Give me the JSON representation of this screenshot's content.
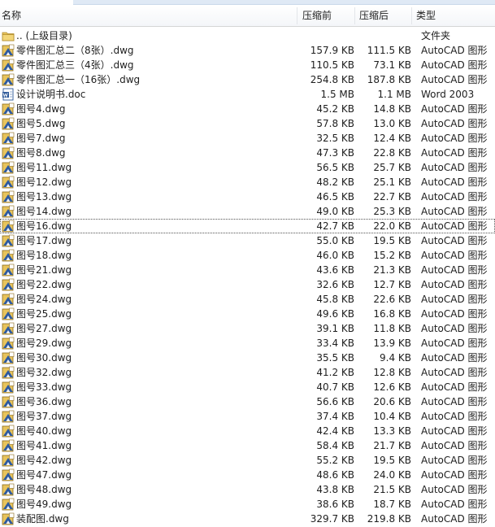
{
  "columns": {
    "name": "名称",
    "compressed": "压缩前",
    "original": "压缩后",
    "type": "类型"
  },
  "icons": {
    "folder": "folder-icon",
    "dwg": "autocad-file-icon",
    "doc": "word-document-icon"
  },
  "colors": {
    "focus_outline": "#555555",
    "header_border": "#d5d5d5",
    "folder_yellow": "#e8c45c",
    "word_blue": "#2b5797"
  },
  "rows": [
    {
      "name": ".. (上级目录)",
      "before": "",
      "after": "",
      "type": "文件夹",
      "icon": "folder"
    },
    {
      "name": "零件图汇总二（8张）.dwg",
      "before": "157.9 KB",
      "after": "111.5 KB",
      "type": "AutoCAD 图形",
      "icon": "dwg"
    },
    {
      "name": "零件图汇总三（4张）.dwg",
      "before": "110.5 KB",
      "after": "73.1 KB",
      "type": "AutoCAD 图形",
      "icon": "dwg"
    },
    {
      "name": "零件图汇总一（16张）.dwg",
      "before": "254.8 KB",
      "after": "187.8 KB",
      "type": "AutoCAD 图形",
      "icon": "dwg"
    },
    {
      "name": "设计说明书.doc",
      "before": "1.5 MB",
      "after": "1.1 MB",
      "type": "Word 2003",
      "icon": "doc"
    },
    {
      "name": "图号4.dwg",
      "before": "45.2 KB",
      "after": "14.8 KB",
      "type": "AutoCAD 图形",
      "icon": "dwg"
    },
    {
      "name": "图号5.dwg",
      "before": "57.8 KB",
      "after": "13.0 KB",
      "type": "AutoCAD 图形",
      "icon": "dwg"
    },
    {
      "name": "图号7.dwg",
      "before": "32.5 KB",
      "after": "12.4 KB",
      "type": "AutoCAD 图形",
      "icon": "dwg"
    },
    {
      "name": "图号8.dwg",
      "before": "47.3 KB",
      "after": "22.8 KB",
      "type": "AutoCAD 图形",
      "icon": "dwg"
    },
    {
      "name": "图号11.dwg",
      "before": "56.5 KB",
      "after": "25.7 KB",
      "type": "AutoCAD 图形",
      "icon": "dwg"
    },
    {
      "name": "图号12.dwg",
      "before": "48.2 KB",
      "after": "25.1 KB",
      "type": "AutoCAD 图形",
      "icon": "dwg"
    },
    {
      "name": "图号13.dwg",
      "before": "46.5 KB",
      "after": "22.7 KB",
      "type": "AutoCAD 图形",
      "icon": "dwg"
    },
    {
      "name": "图号14.dwg",
      "before": "49.0 KB",
      "after": "25.3 KB",
      "type": "AutoCAD 图形",
      "icon": "dwg"
    },
    {
      "name": "图号16.dwg",
      "before": "42.7 KB",
      "after": "22.0 KB",
      "type": "AutoCAD 图形",
      "icon": "dwg",
      "focused": true
    },
    {
      "name": "图号17.dwg",
      "before": "55.0 KB",
      "after": "19.5 KB",
      "type": "AutoCAD 图形",
      "icon": "dwg"
    },
    {
      "name": "图号18.dwg",
      "before": "46.0 KB",
      "after": "15.2 KB",
      "type": "AutoCAD 图形",
      "icon": "dwg"
    },
    {
      "name": "图号21.dwg",
      "before": "43.6 KB",
      "after": "21.3 KB",
      "type": "AutoCAD 图形",
      "icon": "dwg"
    },
    {
      "name": "图号22.dwg",
      "before": "32.6 KB",
      "after": "12.7 KB",
      "type": "AutoCAD 图形",
      "icon": "dwg"
    },
    {
      "name": "图号24.dwg",
      "before": "45.8 KB",
      "after": "22.6 KB",
      "type": "AutoCAD 图形",
      "icon": "dwg"
    },
    {
      "name": "图号25.dwg",
      "before": "49.6 KB",
      "after": "16.8 KB",
      "type": "AutoCAD 图形",
      "icon": "dwg"
    },
    {
      "name": "图号27.dwg",
      "before": "39.1 KB",
      "after": "11.8 KB",
      "type": "AutoCAD 图形",
      "icon": "dwg"
    },
    {
      "name": "图号29.dwg",
      "before": "33.4 KB",
      "after": "13.9 KB",
      "type": "AutoCAD 图形",
      "icon": "dwg"
    },
    {
      "name": "图号30.dwg",
      "before": "35.5 KB",
      "after": "9.4 KB",
      "type": "AutoCAD 图形",
      "icon": "dwg"
    },
    {
      "name": "图号32.dwg",
      "before": "41.2 KB",
      "after": "12.8 KB",
      "type": "AutoCAD 图形",
      "icon": "dwg"
    },
    {
      "name": "图号33.dwg",
      "before": "40.7 KB",
      "after": "12.6 KB",
      "type": "AutoCAD 图形",
      "icon": "dwg"
    },
    {
      "name": "图号36.dwg",
      "before": "56.6 KB",
      "after": "20.6 KB",
      "type": "AutoCAD 图形",
      "icon": "dwg"
    },
    {
      "name": "图号37.dwg",
      "before": "37.4 KB",
      "after": "10.4 KB",
      "type": "AutoCAD 图形",
      "icon": "dwg"
    },
    {
      "name": "图号40.dwg",
      "before": "42.4 KB",
      "after": "13.3 KB",
      "type": "AutoCAD 图形",
      "icon": "dwg"
    },
    {
      "name": "图号41.dwg",
      "before": "58.4 KB",
      "after": "21.7 KB",
      "type": "AutoCAD 图形",
      "icon": "dwg"
    },
    {
      "name": "图号42.dwg",
      "before": "55.2 KB",
      "after": "19.5 KB",
      "type": "AutoCAD 图形",
      "icon": "dwg"
    },
    {
      "name": "图号47.dwg",
      "before": "48.6 KB",
      "after": "24.0 KB",
      "type": "AutoCAD 图形",
      "icon": "dwg"
    },
    {
      "name": "图号48.dwg",
      "before": "43.8 KB",
      "after": "21.5 KB",
      "type": "AutoCAD 图形",
      "icon": "dwg"
    },
    {
      "name": "图号49.dwg",
      "before": "38.6 KB",
      "after": "18.7 KB",
      "type": "AutoCAD 图形",
      "icon": "dwg"
    },
    {
      "name": "装配图.dwg",
      "before": "329.7 KB",
      "after": "219.8 KB",
      "type": "AutoCAD 图形",
      "icon": "dwg"
    }
  ]
}
